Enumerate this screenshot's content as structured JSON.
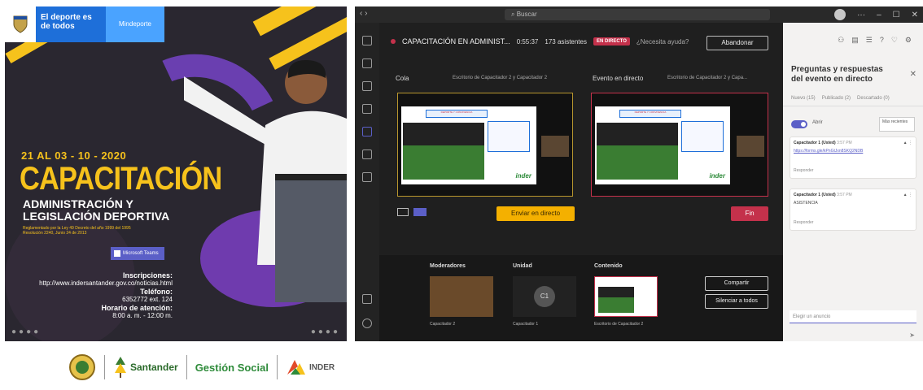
{
  "poster": {
    "brand_top": "El deporte es de todos",
    "brand_ministry": "Mindeporte",
    "dates": "21 AL 03 - 10 - 2020",
    "title": "CAPACITACIÓN",
    "subtitle_line1": "ADMINISTRACIÓN Y",
    "subtitle_line2": "LEGISLACIÓN DEPORTIVA",
    "decree_line1": "Reglamentado por la Ley 49 Decreto del año 1999 del 1995",
    "decree_line2": "Resolución 2240, Junio 24 de 2013",
    "teams_badge": "Microsoft Teams",
    "inscripciones_label": "Inscripciones:",
    "inscripciones_url": "http://www.indersantander.gov.co/noticias.html",
    "telefono_label": "Teléfono:",
    "telefono_value": "6352772 ext. 124",
    "horario_label": "Horario de atención:",
    "horario_value": "8:00 a. m. - 12:00 m.",
    "logo_text_3": "Gestión Social",
    "logo_text_santander": "Santander",
    "logo_text_inder": "INDER",
    "color_yellow": "#f6c21c",
    "color_purple": "#6a3fb0"
  },
  "teams": {
    "search_placeholder": "Buscar",
    "meeting_title": "CAPACITACIÓN EN ADMINIST...",
    "elapsed": "0:55:37",
    "attendees": "173 asistentes",
    "live_label": "EN DIRECTO",
    "network_health": "¿Necesita ayuda?",
    "leave_button": "Abandonar",
    "cola_label": "Cola",
    "cola_source": "Escritorio de Capacitador 2 y Capacitador 2",
    "live_event_label": "Evento en directo",
    "live_source": "Escritorio de Capacitador 2 y Capa...",
    "send_live_button": "Enviar en directo",
    "end_button": "Fin",
    "moderators_label": "Moderadores",
    "unit_label": "Unidad",
    "content_label": "Contenido",
    "moderator_caption": "Capacitador 2",
    "unit_caption": "Capacitador 1",
    "unit_avatar": "C1",
    "content_caption": "Escritorio de Capacitador 2",
    "share_button": "Compartir",
    "message_button": "Silenciar a todos",
    "slide_header": "DEPORTE Y CONVIVENCIA",
    "slide_brand": "inder"
  },
  "qa": {
    "title": "Preguntas y respuestas del evento en directo",
    "tabs": [
      "Nuevo (15)",
      "Publicado (2)",
      "Descartado (0)"
    ],
    "toggle_label": "Abrir",
    "sort_label": "Más recientes",
    "cards": [
      {
        "author": "Capacitador 1 (Usted)",
        "time": "3:57 PM",
        "text": "https://forms.gle/kPnGtJxn8SKQ2NDB",
        "reply": "Responder",
        "is_link": true
      },
      {
        "author": "Capacitador 1 (Usted)",
        "time": "3:57 PM",
        "text": "ASISTENCIA",
        "reply": "Responder",
        "is_link": false
      }
    ],
    "reply_placeholder": "Elegir un anuncio"
  }
}
